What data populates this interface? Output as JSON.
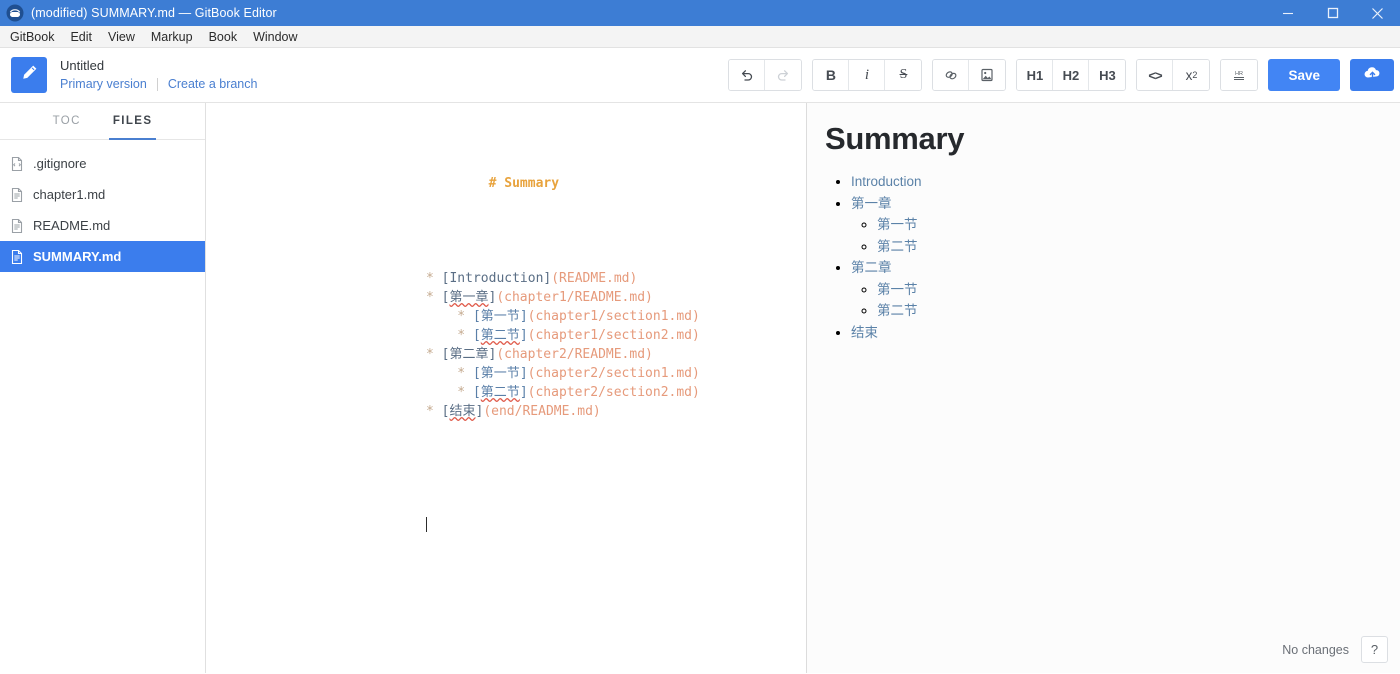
{
  "window": {
    "title": "(modified) SUMMARY.md — GitBook Editor",
    "app_icon": "gitbook-icon",
    "controls": {
      "minimize": "minimize-icon",
      "maximize": "maximize-icon",
      "close": "close-icon"
    }
  },
  "menubar": {
    "items": [
      {
        "label": "GitBook"
      },
      {
        "label": "Edit"
      },
      {
        "label": "View"
      },
      {
        "label": "Markup"
      },
      {
        "label": "Book"
      },
      {
        "label": "Window"
      }
    ]
  },
  "header": {
    "logo_icon": "pencil-icon",
    "book_title": "Untitled",
    "primary_version": "Primary version",
    "create_branch": "Create a branch"
  },
  "toolbar": {
    "groups": [
      {
        "name": "history",
        "buttons": [
          {
            "name": "undo-button",
            "icon": "undo-icon",
            "label": "↺",
            "disabled": false
          },
          {
            "name": "redo-button",
            "icon": "redo-icon",
            "label": "↻",
            "disabled": true
          }
        ]
      },
      {
        "name": "text-format",
        "buttons": [
          {
            "name": "bold-button",
            "icon": "bold-icon",
            "label": "B",
            "disabled": false
          },
          {
            "name": "italic-button",
            "icon": "italic-icon",
            "label": "i",
            "disabled": false
          },
          {
            "name": "strikethrough-button",
            "icon": "strikethrough-icon",
            "label": "S",
            "disabled": false
          }
        ]
      },
      {
        "name": "insert",
        "buttons": [
          {
            "name": "link-button",
            "icon": "link-icon",
            "label": "",
            "disabled": false
          },
          {
            "name": "image-button",
            "icon": "image-icon",
            "label": "",
            "disabled": false
          }
        ]
      },
      {
        "name": "headings",
        "buttons": [
          {
            "name": "heading1-button",
            "icon": "h1-icon",
            "label": "H1",
            "disabled": false
          },
          {
            "name": "heading2-button",
            "icon": "h2-icon",
            "label": "H2",
            "disabled": false
          },
          {
            "name": "heading3-button",
            "icon": "h3-icon",
            "label": "H3",
            "disabled": false
          }
        ]
      },
      {
        "name": "code-script",
        "buttons": [
          {
            "name": "code-button",
            "icon": "code-icon",
            "label": "<>",
            "disabled": false
          },
          {
            "name": "subscript-button",
            "icon": "subscript-icon",
            "label": "x",
            "sub": "2",
            "disabled": false
          }
        ]
      },
      {
        "name": "rule",
        "buttons": [
          {
            "name": "horizontal-rule-button",
            "icon": "horizontal-rule-icon",
            "label": "HR",
            "disabled": false
          }
        ]
      }
    ],
    "save_label": "Save",
    "publish_icon": "cloud-upload-icon"
  },
  "sidebar": {
    "tabs": [
      {
        "name": "tab-toc",
        "label": "TOC",
        "active": false
      },
      {
        "name": "tab-files",
        "label": "FILES",
        "active": true
      }
    ],
    "files": [
      {
        "name": ".gitignore",
        "icon": "gitignore-file-icon",
        "selected": false
      },
      {
        "name": "chapter1.md",
        "icon": "markdown-file-icon",
        "selected": false
      },
      {
        "name": "README.md",
        "icon": "markdown-file-icon",
        "selected": false
      },
      {
        "name": "SUMMARY.md",
        "icon": "markdown-file-icon",
        "selected": true
      }
    ]
  },
  "editor": {
    "heading_line": "# Summary",
    "lines": [
      {
        "indent": 0,
        "bullet": "*",
        "label": "Introduction",
        "url": "(README.md)",
        "misspelled": false
      },
      {
        "indent": 0,
        "bullet": "*",
        "label": "第一章",
        "url": "(chapter1/README.md)",
        "misspelled": true
      },
      {
        "indent": 1,
        "bullet": "*",
        "label": "第一节",
        "url": "(chapter1/section1.md)",
        "misspelled": false
      },
      {
        "indent": 1,
        "bullet": "*",
        "label": "第二节",
        "url": "(chapter1/section2.md)",
        "misspelled": true
      },
      {
        "indent": 0,
        "bullet": "*",
        "label": "第二章",
        "url": "(chapter2/README.md)",
        "misspelled": false
      },
      {
        "indent": 1,
        "bullet": "*",
        "label": "第一节",
        "url": "(chapter2/section1.md)",
        "misspelled": false
      },
      {
        "indent": 1,
        "bullet": "*",
        "label": "第二节",
        "url": "(chapter2/section2.md)",
        "misspelled": true
      },
      {
        "indent": 0,
        "bullet": "*",
        "label": "结束",
        "url": "(end/README.md)",
        "misspelled": true
      }
    ]
  },
  "preview": {
    "title": "Summary",
    "items": [
      {
        "label": "Introduction",
        "children": []
      },
      {
        "label": "第一章",
        "children": [
          {
            "label": "第一节"
          },
          {
            "label": "第二节"
          }
        ]
      },
      {
        "label": "第二章",
        "children": [
          {
            "label": "第一节"
          },
          {
            "label": "第二节"
          }
        ]
      },
      {
        "label": "结束",
        "children": []
      }
    ]
  },
  "statusbar": {
    "status_text": "No changes",
    "help_label": "?"
  },
  "colors": {
    "titlebar": "#3d7dd4",
    "accent": "#3b7ded",
    "save_button": "#4285f4",
    "heading_orange": "#e8a33d",
    "url_orange": "#e69a7b",
    "link_blue": "#5b82a8",
    "spellcheck_red": "#e05b4b"
  }
}
